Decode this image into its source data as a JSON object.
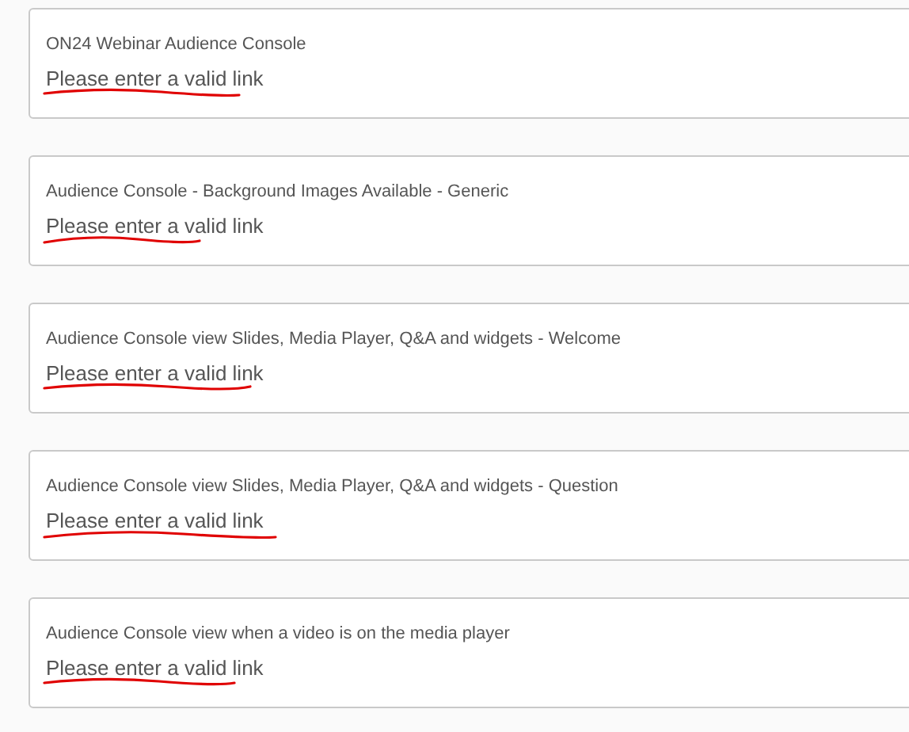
{
  "cards": [
    {
      "title": "ON24 Webinar Audience Console",
      "message": "Please enter a valid link"
    },
    {
      "title": "Audience Console - Background Images Available - Generic",
      "message": "Please enter a valid link"
    },
    {
      "title": "Audience Console view Slides, Media Player, Q&A and widgets - Welcome",
      "message": "Please enter a valid link"
    },
    {
      "title": "Audience Console view Slides, Media Player, Q&A and widgets - Question",
      "message": "Please enter a valid link"
    },
    {
      "title": "Audience Console view when a video is on the media player",
      "message": "Please enter a valid link"
    }
  ]
}
